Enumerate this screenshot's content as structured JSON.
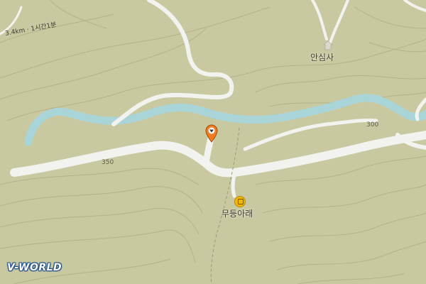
{
  "map": {
    "colors": {
      "land": "#c9c9a1",
      "contour": "#b3b38a",
      "river": "#a9d5d9",
      "road": "#f2f2ee",
      "marker": "#f07c1e"
    },
    "poi": {
      "temple": "안심사",
      "bus_stop": "무등아래"
    },
    "contours": {
      "c350": "350",
      "c300": "300"
    },
    "trail_label": "3.4km · 1시간1분",
    "logo": "V-WORLD",
    "icons": {
      "marker": "map-pin-icon",
      "bus": "bus-stop-icon",
      "temple": "temple-icon"
    }
  }
}
